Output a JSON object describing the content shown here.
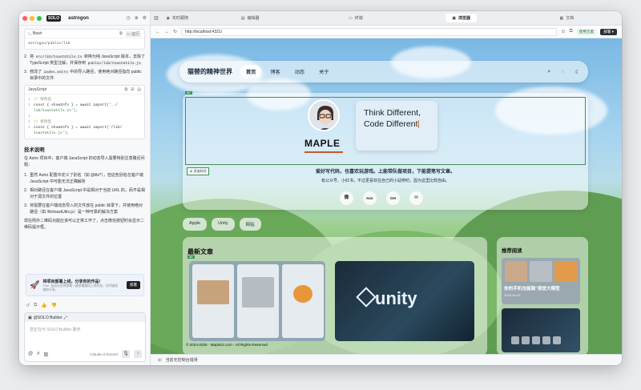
{
  "left": {
    "solo_badge": "SOLO",
    "project": "astrogon",
    "bash_card": {
      "lang": "Bash",
      "run": "运行",
      "code": "astrogon/public/lib"
    },
    "steps_a": [
      {
        "n": "2.",
        "pre": "将",
        "code": "src/lib/toastUtils.ts",
        "mid": "转换为纯 JavaScript 版本，去除了 TypeScript 类型注解，并保存到",
        "code2": "public/lib/toastUtils.js"
      },
      {
        "n": "3.",
        "pre": "修改了",
        "code": "index.astro",
        "mid": "中的导入路径，使用绝对路径指向 public 目录中的文件:",
        "code2": ""
      }
    ],
    "js_card": {
      "lang": "JavaScript",
      "lines": [
        {
          "n": "1",
          "cls": "cm",
          "text": "// 修改前"
        },
        {
          "n": "2",
          "cls": "",
          "text": "const { showInfo } = await import('../"
        },
        {
          "n": "",
          "cls": "str",
          "text": "lib/toastUtils.ts');"
        },
        {
          "n": "3",
          "cls": "",
          "text": ""
        },
        {
          "n": "4",
          "cls": "cm",
          "text": "// 修改后"
        },
        {
          "n": "5",
          "cls": "",
          "text": "const { showInfo } = await import('/lib/"
        },
        {
          "n": "",
          "cls": "str",
          "text": "toastUtils.js');"
        }
      ]
    },
    "tech_title": "技术说明",
    "tech_intro": "在 Astro 项目中，客户端 JavaScript 的动态导入需要特别注意路径问题：",
    "steps_b": [
      {
        "n": "1.",
        "text": "虽然 Astro 配置中定义了别名（如 @lib/*），但这些别名在客户端 JavaScript 中可能无法正确解析"
      },
      {
        "n": "2.",
        "text": "相对路径在客户端 JavaScript 中是相对于当前 URL 的，而不是相对于源文件的位置"
      },
      {
        "n": "3.",
        "text": "将需要在客户端动态导入的文件放在 public 目录下，并使用绝对路径（如 /lib/toastUtils.js）是一种可靠的解决方案"
      }
    ],
    "closing": "现在例外二维码功能应该可以正常工作了，点击微信按钮时会显示二维码提示框。",
    "promo": {
      "title": "将项目部署上线，分享你的作品!",
      "sub": "Free, 自动化支持部署一键部署通知上线状态，访问链接随你分享。",
      "btn": "部署"
    },
    "chat": {
      "mention": "@SOLO Builder",
      "placeholder": "您正在与 SOLO Builder 聊天",
      "model": "Claude-4-Sonnet"
    }
  },
  "tabs": [
    {
      "label": "实时跟随",
      "active": false
    },
    {
      "label": "编辑器",
      "active": false
    },
    {
      "label": "终端",
      "active": false
    },
    {
      "label": "浏览器",
      "active": true
    },
    {
      "label": "文档",
      "active": false
    }
  ],
  "browser": {
    "url": "http://localhost:4321/",
    "deploy_hint": "使用元素",
    "deploy": "部署"
  },
  "site": {
    "title": "猫替的精神世界",
    "menu": [
      "首页",
      "博客",
      "动态",
      "关于"
    ],
    "bubble_l1": "Think Different,",
    "bubble_l2": "Code Different",
    "name": "MAPLE",
    "add_time": "添加时间",
    "slogan1": "爱好写代码，也喜欢玩游戏。上能带队做项目，下能提笔写文章。",
    "slogan2": "有公众号、小红书，不过更喜欢在自己的小站唠叨，因为这里比较自由。",
    "socials": [
      "微",
      "RSS",
      "GH",
      "✉"
    ],
    "tags": [
      "Apple",
      "Unity",
      "网站"
    ],
    "latest_title": "最新文章",
    "unity": "unity",
    "footer": "© 2024-2025 · Maplezz.com · All Rights Reserved",
    "rec_title": "推荐阅读",
    "rec1_title": "你的手机也能跑\"视觉大模型",
    "rec1_date": "2025-06-25"
  },
  "console": {
    "count": "0",
    "text": "当前无控制台错误"
  },
  "colors": {
    "accent": "#3f8f5b",
    "deploy": "#2c2f36"
  }
}
